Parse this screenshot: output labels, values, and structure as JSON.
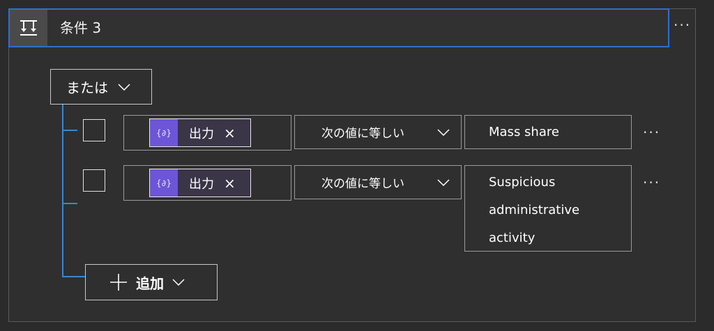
{
  "header": {
    "title": "条件 3",
    "icon": "condition-branch-icon",
    "more_label": "···"
  },
  "group": {
    "operator_label": "または"
  },
  "rows": [
    {
      "token_label": "出力",
      "token_icon_text": "{∂}",
      "token_remove": "×",
      "operator": "次の値に等しい",
      "value_lines": [
        "Mass share"
      ],
      "more_label": "···"
    },
    {
      "token_label": "出力",
      "token_icon_text": "{∂}",
      "token_remove": "×",
      "operator": "次の値に等しい",
      "value_lines": [
        "Suspicious",
        "administrative",
        "activity"
      ],
      "more_label": "···"
    }
  ],
  "add": {
    "label": "追加"
  },
  "colors": {
    "accent": "#2f6fd1",
    "tree_line": "#3a86d4",
    "token_bg": "#6d55d8",
    "background": "#2b2b2b"
  }
}
